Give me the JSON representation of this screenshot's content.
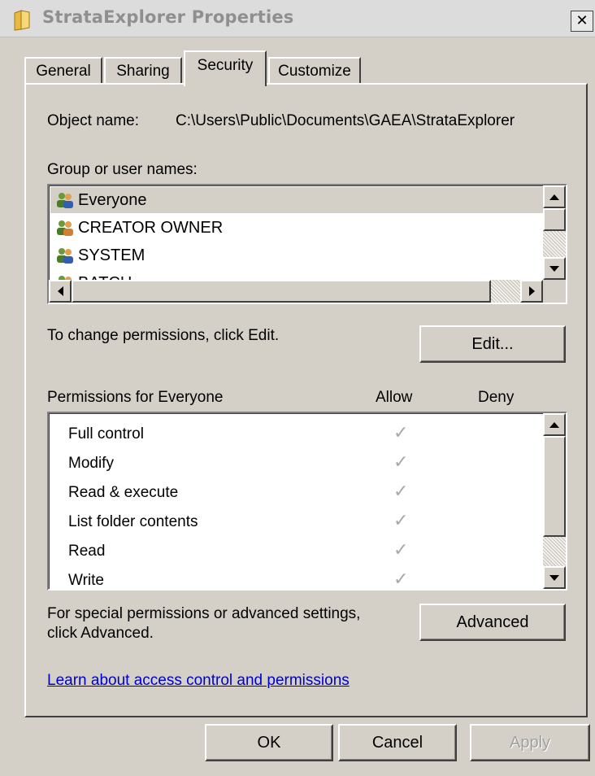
{
  "window": {
    "title": "StrataExplorer Properties",
    "close_glyph": "✕"
  },
  "tabs": [
    {
      "label": "General",
      "active": false
    },
    {
      "label": "Sharing",
      "active": false
    },
    {
      "label": "Security",
      "active": true
    },
    {
      "label": "Customize",
      "active": false
    }
  ],
  "security": {
    "object_name_label": "Object name:",
    "object_name_value": "C:\\Users\\Public\\Documents\\GAEA\\StrataExplorer",
    "group_label": "Group or user names:",
    "users": [
      {
        "name": "Everyone",
        "selected": true
      },
      {
        "name": "CREATOR OWNER",
        "selected": false
      },
      {
        "name": "SYSTEM",
        "selected": false
      },
      {
        "name": "BATCH",
        "selected": false
      }
    ],
    "change_hint": "To change permissions, click Edit.",
    "edit_button": "Edit...",
    "permissions_header": "Permissions for Everyone",
    "allow_header": "Allow",
    "deny_header": "Deny",
    "permissions": [
      {
        "name": "Full control",
        "allow": true,
        "deny": false
      },
      {
        "name": "Modify",
        "allow": true,
        "deny": false
      },
      {
        "name": "Read & execute",
        "allow": true,
        "deny": false
      },
      {
        "name": "List folder contents",
        "allow": true,
        "deny": false
      },
      {
        "name": "Read",
        "allow": true,
        "deny": false
      },
      {
        "name": "Write",
        "allow": true,
        "deny": false
      }
    ],
    "check_glyph": "✓",
    "advanced_hint_line1": "For special permissions or advanced settings,",
    "advanced_hint_line2": "click Advanced.",
    "advanced_button": "Advanced",
    "learn_link": "Learn about access control and permissions"
  },
  "footer": {
    "ok": "OK",
    "cancel": "Cancel",
    "apply": "Apply"
  },
  "colors": {
    "face": "#d4d0c8",
    "link": "#0000cc",
    "title_text": "#8f8f8f"
  }
}
